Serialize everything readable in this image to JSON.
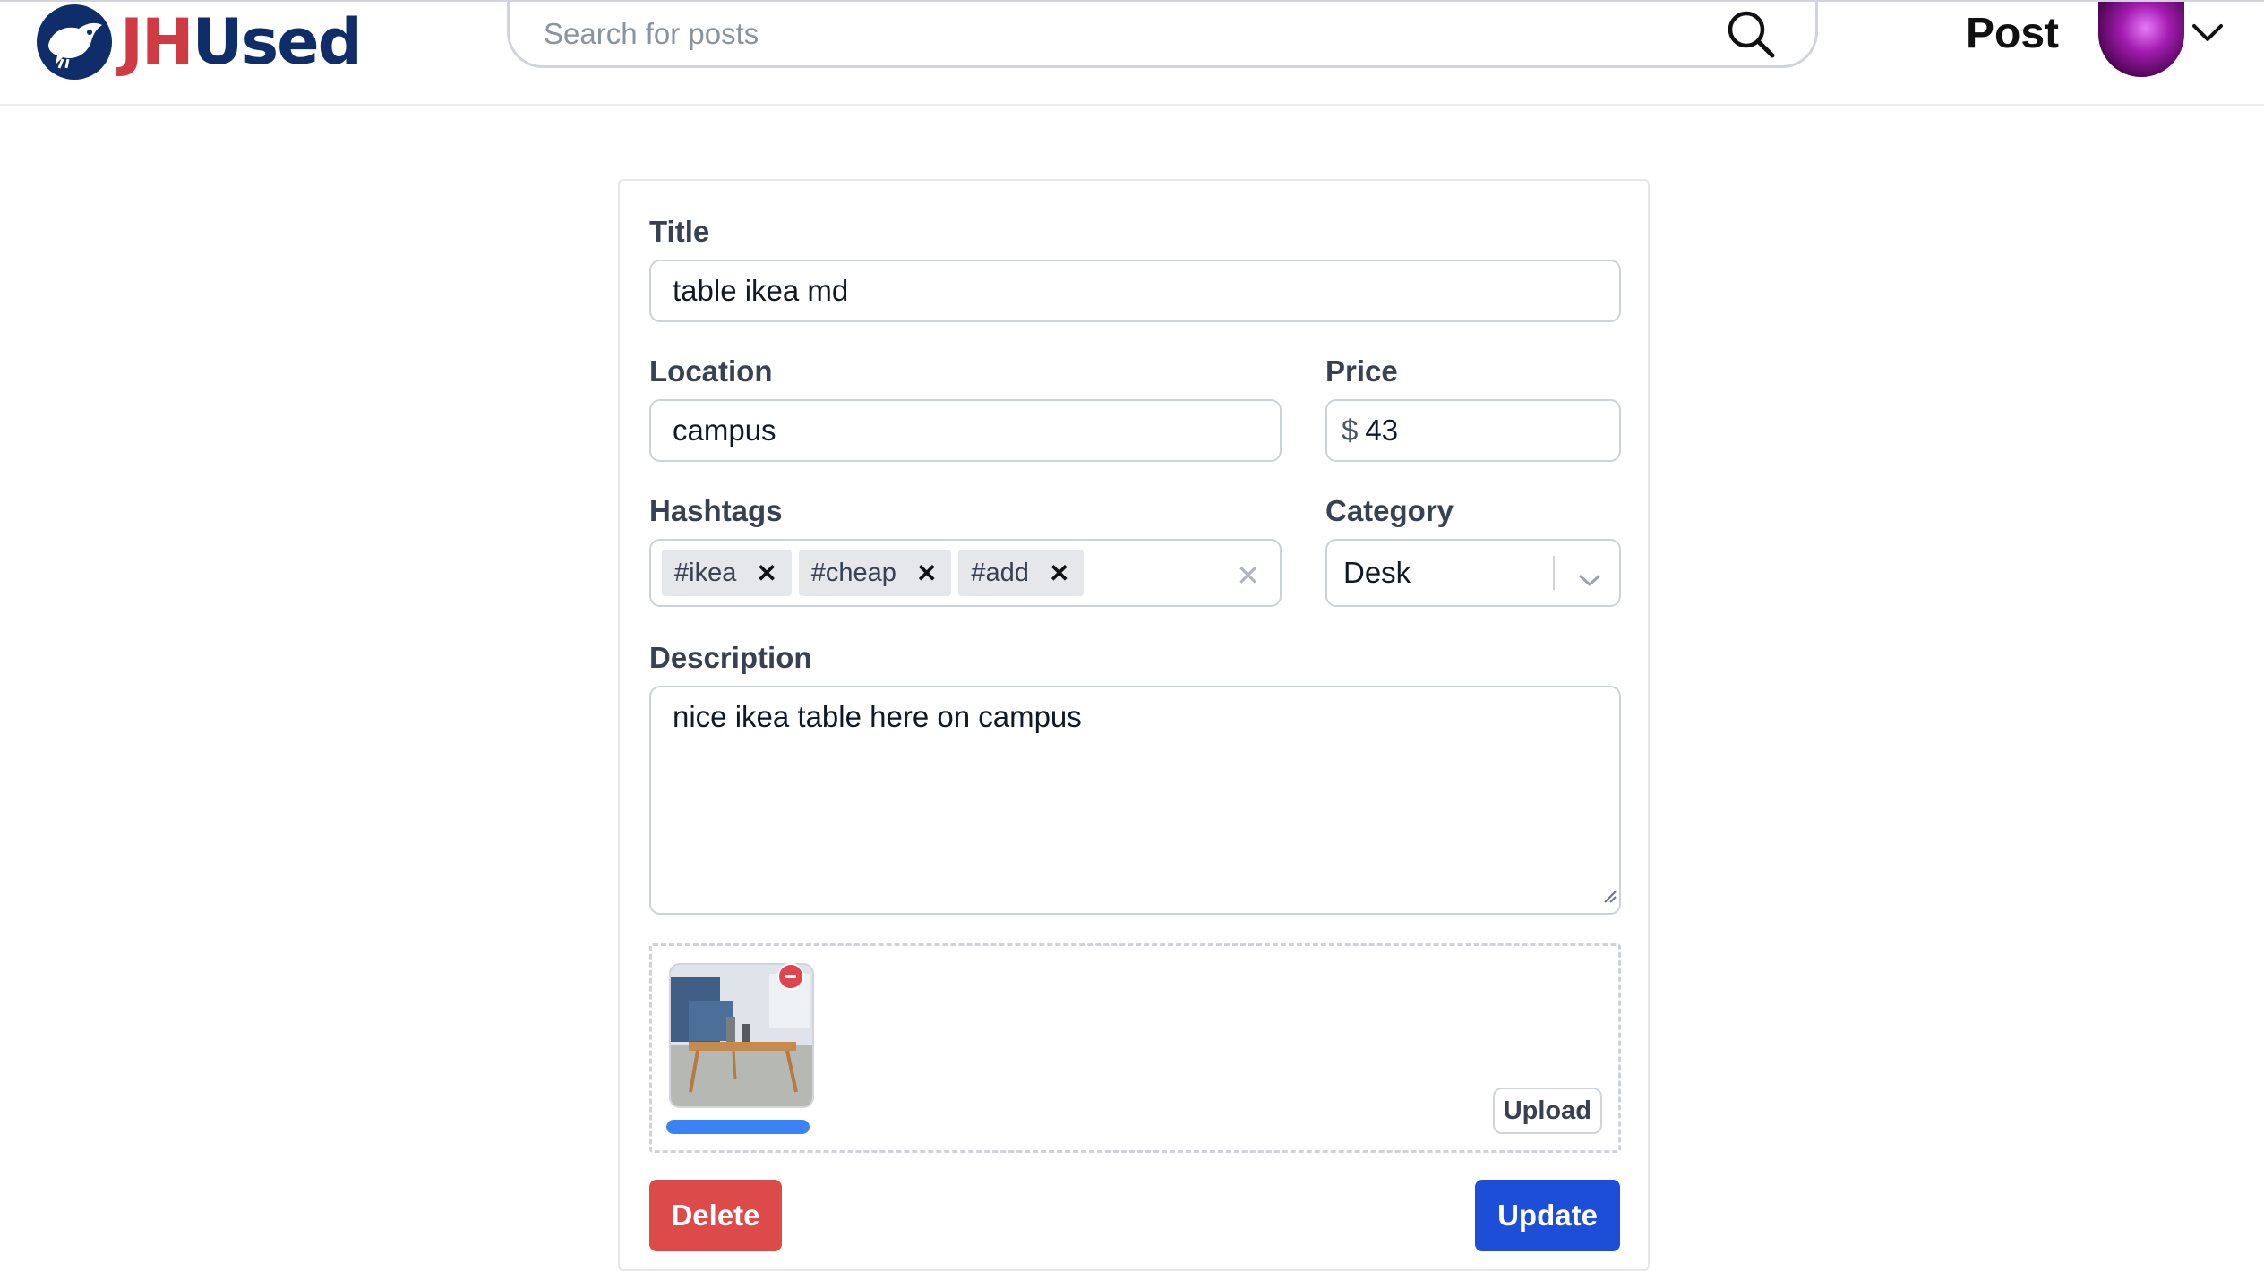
{
  "header": {
    "logo_prefix": "JH",
    "logo_suffix": "Used",
    "search_placeholder": "Search for posts",
    "post_link": "Post",
    "icons": [
      "bird-logo-icon",
      "search-icon",
      "chevron-down-icon"
    ]
  },
  "form": {
    "title_label": "Title",
    "title_value": "table ikea md",
    "location_label": "Location",
    "location_value": "campus",
    "price_label": "Price",
    "price_currency": "$",
    "price_value": "43",
    "hashtags_label": "Hashtags",
    "hashtags": [
      "#ikea",
      "#cheap",
      "#add"
    ],
    "category_label": "Category",
    "category_value": "Desk",
    "description_label": "Description",
    "description_value": "nice ikea table here on campus",
    "upload_label": "Upload",
    "upload_progress": 1.0,
    "delete_label": "Delete",
    "update_label": "Update"
  },
  "colors": {
    "brand_red": "#cf3a44",
    "brand_navy": "#0f2d69",
    "delete": "#dc4a4a",
    "update": "#1d4ed8",
    "progress": "#3b82f6"
  }
}
